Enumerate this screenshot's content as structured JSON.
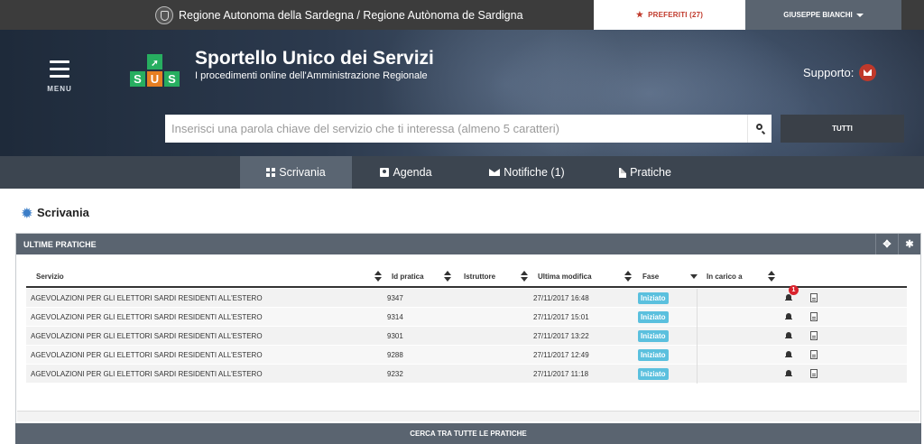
{
  "topbar": {
    "region": "Regione Autonoma della Sardegna / Regione Autònoma de Sardigna",
    "favorites_label": "PREFERITI (27)",
    "user_name": "GIUSEPPE BIANCHI"
  },
  "hero": {
    "menu_label": "MENU",
    "logo_letters": [
      "S",
      "U",
      "S"
    ],
    "title": "Sportello Unico dei Servizi",
    "subtitle": "I procedimenti online dell'Amministrazione Regionale",
    "support_label": "Supporto:",
    "search_placeholder": "Inserisci una parola chiave del servizio che ti interessa (almeno 5 caratteri)",
    "scope_button": "TUTTI"
  },
  "nav": {
    "items": [
      {
        "label": "Scrivania",
        "icon": "grid-icon",
        "active": true
      },
      {
        "label": "Agenda",
        "icon": "address-book-icon",
        "active": false
      },
      {
        "label": "Notifiche (1)",
        "icon": "envelope-icon",
        "active": false
      },
      {
        "label": "Pratiche",
        "icon": "file-icon",
        "active": false
      }
    ]
  },
  "page": {
    "title": "Scrivania"
  },
  "panel": {
    "title": "ULTIME PRATICHE",
    "columns": [
      "Servizio",
      "Id pratica",
      "Istruttore",
      "Ultima modifica",
      "Fase",
      "In carico a"
    ],
    "rows": [
      {
        "servizio": "AGEVOLAZIONI PER GLI ELETTORI SARDI RESIDENTI ALL'ESTERO",
        "id": "9347",
        "istruttore": "",
        "modifica": "27/11/2017 16:48",
        "fase": "Iniziato",
        "carico": "",
        "notifications": "1"
      },
      {
        "servizio": "AGEVOLAZIONI PER GLI ELETTORI SARDI RESIDENTI ALL'ESTERO",
        "id": "9314",
        "istruttore": "",
        "modifica": "27/11/2017 15:01",
        "fase": "Iniziato",
        "carico": "",
        "notifications": ""
      },
      {
        "servizio": "AGEVOLAZIONI PER GLI ELETTORI SARDI RESIDENTI ALL'ESTERO",
        "id": "9301",
        "istruttore": "",
        "modifica": "27/11/2017 13:22",
        "fase": "Iniziato",
        "carico": "",
        "notifications": ""
      },
      {
        "servizio": "AGEVOLAZIONI PER GLI ELETTORI SARDI RESIDENTI ALL'ESTERO",
        "id": "9288",
        "istruttore": "",
        "modifica": "27/11/2017 12:49",
        "fase": "Iniziato",
        "carico": "",
        "notifications": ""
      },
      {
        "servizio": "AGEVOLAZIONI PER GLI ELETTORI SARDI RESIDENTI ALL'ESTERO",
        "id": "9232",
        "istruttore": "",
        "modifica": "27/11/2017 11:18",
        "fase": "Iniziato",
        "carico": "",
        "notifications": ""
      }
    ],
    "footer_button": "CERCA TRA TUTTE LE PRATICHE"
  },
  "colors": {
    "topbar": "#3c3c3c",
    "nav": "#3c4550",
    "panel_header": "#5a6470",
    "badge": "#5bc0de",
    "accent_red": "#c0392b",
    "logo_green": "#27ae60",
    "logo_orange": "#e67e22"
  }
}
